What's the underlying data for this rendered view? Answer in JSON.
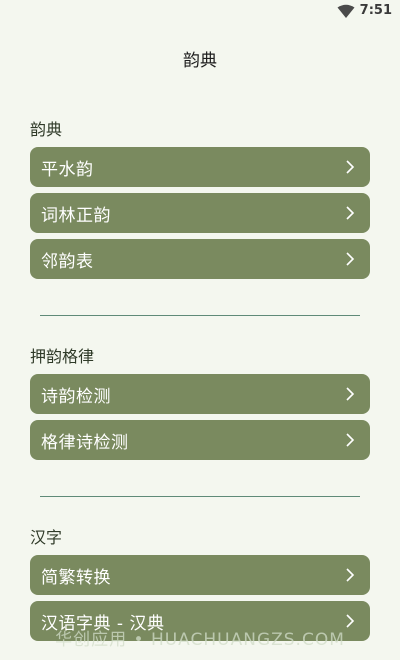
{
  "status_bar": {
    "time": "7:51",
    "wifi_icon": "wifi-icon"
  },
  "app_title": "韵典",
  "colors": {
    "background": "#f4f7ef",
    "button": "#7a8a5f",
    "divider": "#5f8a78"
  },
  "sections": [
    {
      "title": "韵典",
      "items": [
        {
          "label": "平水韵",
          "icon": "chevron-right-icon"
        },
        {
          "label": "词林正韵",
          "icon": "chevron-right-icon"
        },
        {
          "label": "邻韵表",
          "icon": "chevron-right-icon"
        }
      ]
    },
    {
      "title": "押韵格律",
      "items": [
        {
          "label": "诗韵检测",
          "icon": "chevron-right-icon"
        },
        {
          "label": "格律诗检测",
          "icon": "chevron-right-icon"
        }
      ]
    },
    {
      "title": "汉字",
      "items": [
        {
          "label": "简繁转换",
          "icon": "chevron-right-icon"
        },
        {
          "label": "汉语字典 - 汉典",
          "icon": "chevron-right-icon"
        }
      ]
    }
  ],
  "watermark": "华创应用 • HUACHUANGZS.COM"
}
